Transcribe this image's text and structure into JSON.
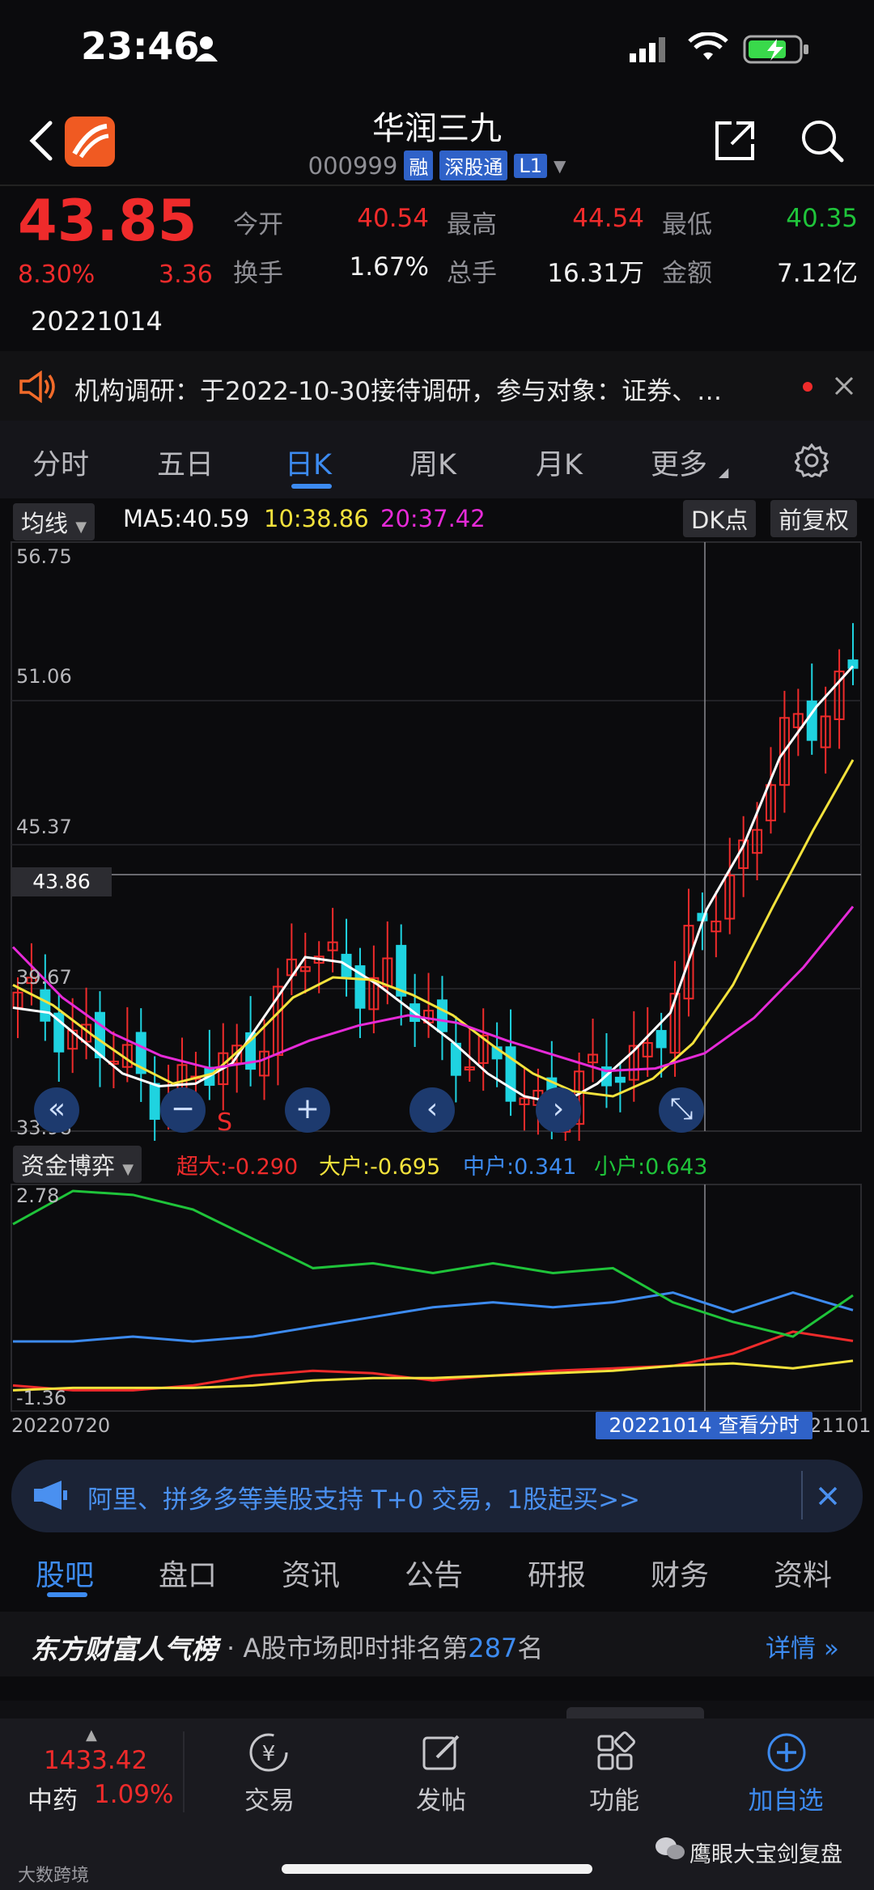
{
  "status": {
    "time": "23:46"
  },
  "header": {
    "title": "华润三九",
    "code": "000999",
    "badges": [
      "融",
      "深股通",
      "L1"
    ]
  },
  "quote": {
    "price": "43.85",
    "change_pct": "8.30%",
    "change": "3.36",
    "date": "20221014",
    "fields": [
      {
        "label": "今开",
        "value": "40.54",
        "color": "red"
      },
      {
        "label": "最高",
        "value": "44.54",
        "color": "red"
      },
      {
        "label": "最低",
        "value": "40.35",
        "color": "green"
      },
      {
        "label": "换手",
        "value": "1.67%",
        "color": "white"
      },
      {
        "label": "总手",
        "value": "16.31万",
        "color": "white"
      },
      {
        "label": "金额",
        "value": "7.12亿",
        "color": "white"
      }
    ]
  },
  "notice": {
    "text": "机构调研：于2022-10-30接待调研，参与对象：证券、…"
  },
  "chart_tabs": [
    "分时",
    "五日",
    "日K",
    "周K",
    "月K",
    "更多"
  ],
  "indicators": {
    "ma_select": "均线",
    "ma5": "MA5:40.59",
    "ma10": "10:38.86",
    "ma20": "20:37.42",
    "dk_button": "DK点",
    "adjust_button": "前复权"
  },
  "price_axis": {
    "labels": [
      "56.75",
      "51.06",
      "45.37",
      "39.67",
      "33.98"
    ],
    "crosshair_price": "43.86",
    "signal": "S"
  },
  "fund": {
    "select": "资金博弈",
    "super": "超大:-0.290",
    "large": "大户:-0.695",
    "medium": "中户:0.341",
    "small": "小户:0.643",
    "axis_top": "2.78",
    "axis_bottom": "-1.36",
    "start_date": "20220720",
    "end_date_fragment": "21101",
    "view_intraday": "20221014 查看分时"
  },
  "promo": {
    "text": "阿里、拼多多等美股支持 T+0 交易，1股起买>>"
  },
  "community_tabs": [
    "股吧",
    "盘口",
    "资讯",
    "公告",
    "研报",
    "财务",
    "资料"
  ],
  "ranking": {
    "brand": "东方财富人气榜",
    "text_prefix": "· A股市场即时排名第",
    "rank": "287",
    "text_suffix": "名",
    "detail": "详情"
  },
  "bottom_bar": {
    "index_value": "1433.42",
    "index_name": "中药",
    "index_pct": "1.09%",
    "items": [
      "交易",
      "发帖",
      "功能",
      "加自选"
    ]
  },
  "watermark": {
    "left": "大数跨境",
    "right": "鹰眼大宝剑复盘"
  },
  "colors": {
    "up": "#ef2b2b",
    "down": "#1fd3e0",
    "ma5": "#ffffff",
    "ma10": "#f3e23c",
    "ma20": "#e62ad8",
    "accent": "#3d8bf0"
  },
  "chart_data": [
    {
      "type": "line",
      "title": "",
      "series": [
        {
          "name": "MA5",
          "values": [
            38.6,
            38.4,
            37.2,
            36.0,
            35.5,
            35.6,
            36.4,
            38.5,
            40.6,
            40.4,
            39.5,
            38.4,
            37.3,
            36.0,
            35.1,
            34.8,
            35.6,
            36.9,
            38.4,
            42.5,
            45.0,
            48.5,
            50.5,
            52.1
          ]
        },
        {
          "name": "10",
          "values": [
            39.5,
            38.7,
            37.5,
            36.4,
            35.6,
            36.0,
            37.4,
            39.0,
            39.8,
            39.7,
            39.1,
            38.3,
            37.1,
            36.0,
            35.3,
            35.1,
            35.8,
            37.2,
            39.5,
            42.6,
            45.6,
            48.4
          ]
        },
        {
          "name": "20",
          "values": [
            41.0,
            39.0,
            37.6,
            36.7,
            36.2,
            36.5,
            37.3,
            37.9,
            38.3,
            38.0,
            37.3,
            36.7,
            36.1,
            36.2,
            36.8,
            38.2,
            40.2,
            42.6
          ]
        }
      ],
      "ylim": [
        33.98,
        56.75
      ]
    },
    {
      "type": "line",
      "title": "",
      "series": [
        {
          "name": "超大",
          "values": [
            -1.2,
            -1.3,
            -1.3,
            -1.2,
            -1.0,
            -0.9,
            -0.95,
            -1.1,
            -1.0,
            -0.9,
            -0.85,
            -0.8,
            -0.55,
            -0.1,
            -0.29
          ]
        },
        {
          "name": "大户",
          "values": [
            -1.3,
            -1.25,
            -1.25,
            -1.25,
            -1.2,
            -1.1,
            -1.05,
            -1.05,
            -1.0,
            -0.95,
            -0.9,
            -0.8,
            -0.75,
            -0.85,
            -0.695
          ]
        },
        {
          "name": "中户",
          "values": [
            -0.3,
            -0.3,
            -0.2,
            -0.3,
            -0.2,
            0.0,
            0.2,
            0.4,
            0.5,
            0.4,
            0.5,
            0.7,
            0.3,
            0.7,
            0.341
          ]
        },
        {
          "name": "小户",
          "values": [
            2.1,
            2.78,
            2.7,
            2.4,
            1.8,
            1.2,
            1.3,
            1.1,
            1.3,
            1.1,
            1.2,
            0.5,
            0.1,
            -0.2,
            0.643
          ]
        }
      ],
      "ylim": [
        -1.36,
        2.78
      ]
    }
  ]
}
